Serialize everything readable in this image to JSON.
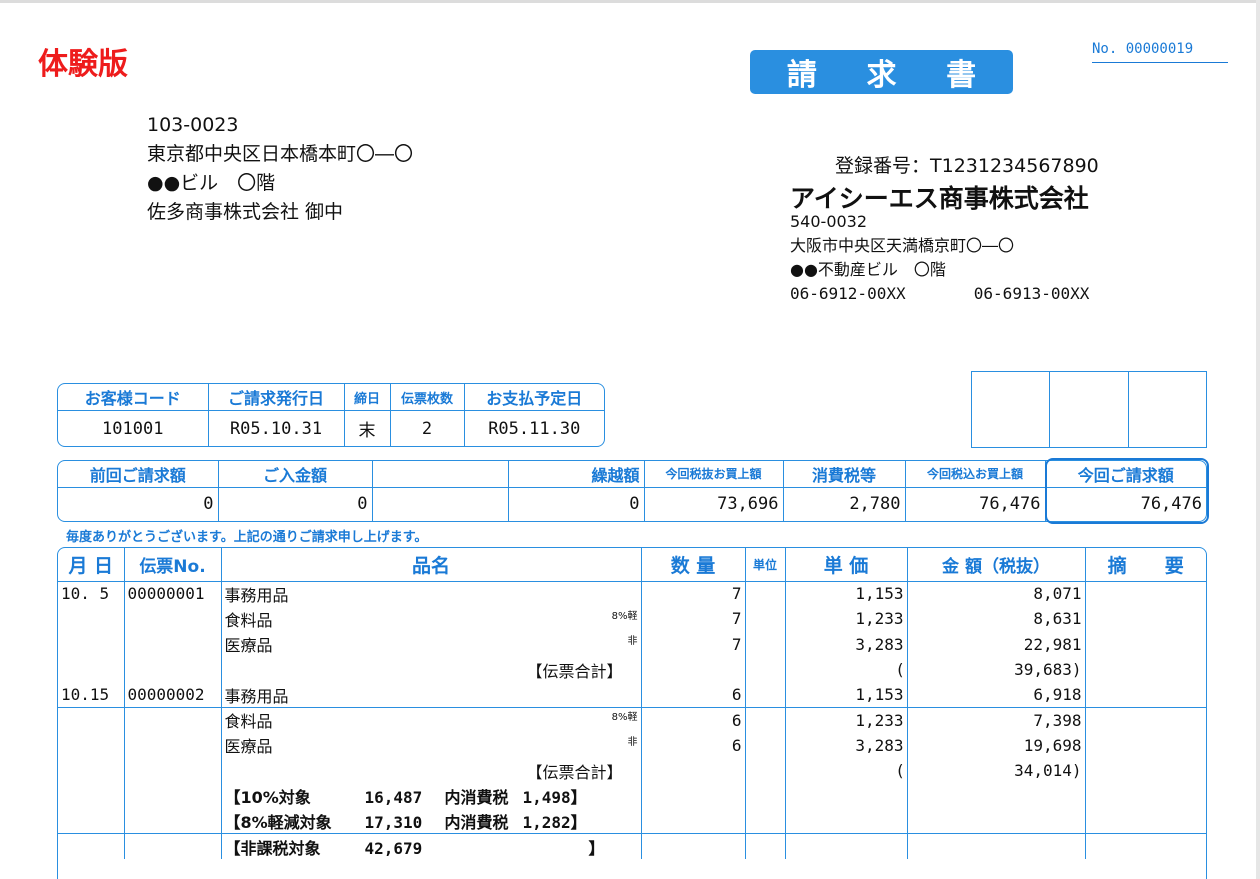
{
  "trial_label": "体験版",
  "title_chars": [
    "請",
    "求",
    "書"
  ],
  "invoice_no": "No. 00000019",
  "customer": {
    "zip": "103-0023",
    "addr1": "東京都中央区日本橋本町〇―〇",
    "addr2": "●●ビル　〇階",
    "name": "佐多商事株式会社 御中"
  },
  "issuer": {
    "registration": "登録番号：T1231234567890",
    "name": "アイシーエス商事株式会社",
    "zip": "540-0032",
    "addr1": "大阪市中央区天満橋京町〇―〇",
    "addr2": "●●不動産ビル　〇階",
    "tel": "06-6912-00XX",
    "fax": "06-6913-00XX"
  },
  "summary": {
    "headers": [
      "お客様コード",
      "ご請求発行日",
      "締日",
      "伝票枚数",
      "お支払予定日"
    ],
    "values": [
      "101001",
      "R05.10.31",
      "末",
      "2",
      "R05.11.30"
    ]
  },
  "totals": {
    "headers": [
      "前回ご請求額",
      "ご入金額",
      "",
      "繰越額",
      "今回税抜お買上額",
      "消費税等",
      "今回税込お買上額",
      "今回ご請求額"
    ],
    "values": [
      "0",
      "0",
      "",
      "0",
      "73,696",
      "2,780",
      "76,476",
      "76,476"
    ]
  },
  "thanks": "毎度ありがとうございます。上記の通りご請求申し上げます。",
  "detail": {
    "headers": [
      "月 日",
      "伝票No.",
      "品名",
      "数 量",
      "単位",
      "単 価",
      "金 額（税抜）",
      "摘　　要"
    ],
    "rows": [
      {
        "date": "10. 5",
        "slip": "00000001",
        "item": "事務用品",
        "tax": "",
        "qty": "7",
        "price": "1,153",
        "amount": "8,071"
      },
      {
        "date": "",
        "slip": "",
        "item": "食料品",
        "tax": "8%軽",
        "qty": "7",
        "price": "1,233",
        "amount": "8,631"
      },
      {
        "date": "",
        "slip": "",
        "item": "医療品",
        "tax": "非",
        "qty": "7",
        "price": "3,283",
        "amount": "22,981"
      },
      {
        "date": "",
        "slip": "",
        "subtotal_label": "【伝票合計】",
        "subtotal": "39,683"
      },
      {
        "date": "10.15",
        "slip": "00000002",
        "item": "事務用品",
        "tax": "",
        "qty": "6",
        "price": "1,153",
        "amount": "6,918"
      },
      {
        "date": "",
        "slip": "",
        "item": "食料品",
        "tax": "8%軽",
        "qty": "6",
        "price": "1,233",
        "amount": "7,398"
      },
      {
        "date": "",
        "slip": "",
        "item": "医療品",
        "tax": "非",
        "qty": "6",
        "price": "3,283",
        "amount": "19,698"
      },
      {
        "date": "",
        "slip": "",
        "subtotal_label": "【伝票合計】",
        "subtotal": "34,014"
      }
    ],
    "tax_summary": [
      {
        "label": "【10%対象",
        "amount": "16,487",
        "tax_label": "内消費税",
        "tax": "1,498】"
      },
      {
        "label": "【8%軽減対象",
        "amount": "17,310",
        "tax_label": "内消費税",
        "tax": "1,282】"
      },
      {
        "label": "【非課税対象",
        "amount": "42,679",
        "tax_label": "",
        "tax": "】"
      }
    ]
  }
}
